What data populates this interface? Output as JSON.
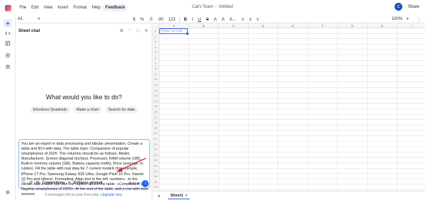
{
  "menu": [
    "File",
    "Edit",
    "View",
    "Insert",
    "Format",
    "Help",
    "Feedback"
  ],
  "document": {
    "team": "Cat's Team",
    "separator": "/",
    "title": "Untitled"
  },
  "user": {
    "avatar_initial": "C",
    "share_label": "Share"
  },
  "formula_bar": {
    "cell_ref": "A1",
    "fx": "fx",
    "zoom": "100%"
  },
  "toolbar": [
    "$",
    "%",
    ".0",
    ".00",
    "123",
    "B",
    "I",
    "U",
    "S",
    "A",
    "A",
    "A→",
    "≡",
    "≡",
    "≡"
  ],
  "chat": {
    "title": "Sheet chat",
    "heading": "What would you like to do?",
    "suggestions": [
      "Introduce Quadratic",
      "Make a chart",
      "Search for data"
    ],
    "input_text": "You are an expert in data processing and tabular presentation. Create a table and fill it with data. The table topic: Comparison of popular smartphones of 2025. The columns should be as follows: Model, Manufacturer, Screen diagonal (inches), Processor, RAM volume (GB), Built-in memory volume (GB), Battery capacity (mAh), Price (average, in rubles). Fill the table with real data for 7 current models (for example, iPhone 17 Pro, Samsung Galaxy S25 Ultra, Google Pixel 10 Pro, Xiaomi 15 Pro and others). Formatting: Align text to the left, numbers - to the center. Add a table title with the caption above the table: «Comparison of flagship smartphones of 2025». At the end of the table, add a row with data sources.",
    "tools": {
      "connections": "Connections",
      "enhance": "Enhance prompt",
      "auto": "Auto"
    },
    "footer_text": "5 messages left on your Free plan.",
    "footer_link": "Upgrade now."
  },
  "grid": {
    "columns": [
      "A",
      "B",
      "C",
      "D",
      "E",
      "F",
      "G",
      "H",
      "I"
    ],
    "rows": [
      "1",
      "2",
      "3",
      "4",
      "5",
      "6",
      "7",
      "8",
      "9",
      "10",
      "11",
      "12",
      "13",
      "14",
      "15",
      "16",
      "17",
      "18",
      "19",
      "20",
      "21",
      "22",
      "23",
      "24",
      "25",
      "26",
      "27",
      "28",
      "29",
      "30"
    ],
    "cell_placeholder": "Press / to code"
  },
  "sheets": {
    "add": "+",
    "active": "Sheet1"
  },
  "colors": {
    "accent": "#2a66f0",
    "arrow": "#d4263a"
  }
}
